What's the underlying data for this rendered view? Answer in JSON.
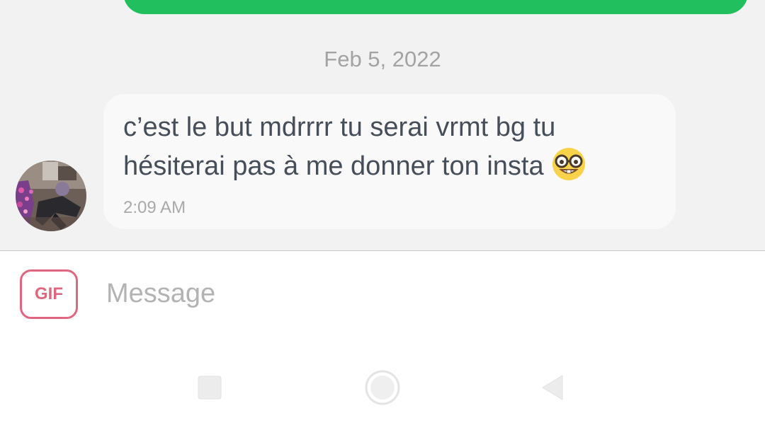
{
  "colors": {
    "chat_background": "#f2f2f2",
    "sent_bubble": "#22bf5e",
    "received_bubble": "#f9f9f9",
    "message_text": "#464e5a",
    "muted_text": "#a3a3a3",
    "accent_pink": "#e0667f"
  },
  "conversation": {
    "date_separator": "Feb 5, 2022",
    "received_message": {
      "text": "c’est le but mdrrrr tu serai vrmt bg tu hésiterai pas à me donner ton insta",
      "emoji": "nerd-face-icon",
      "time": "2:09 AM"
    }
  },
  "composer": {
    "gif_label": "GIF",
    "input_value": "",
    "input_placeholder": "Message"
  },
  "nav_bar": {
    "recents_icon": "square-icon",
    "home_icon": "circle-icon",
    "back_icon": "triangle-icon"
  }
}
